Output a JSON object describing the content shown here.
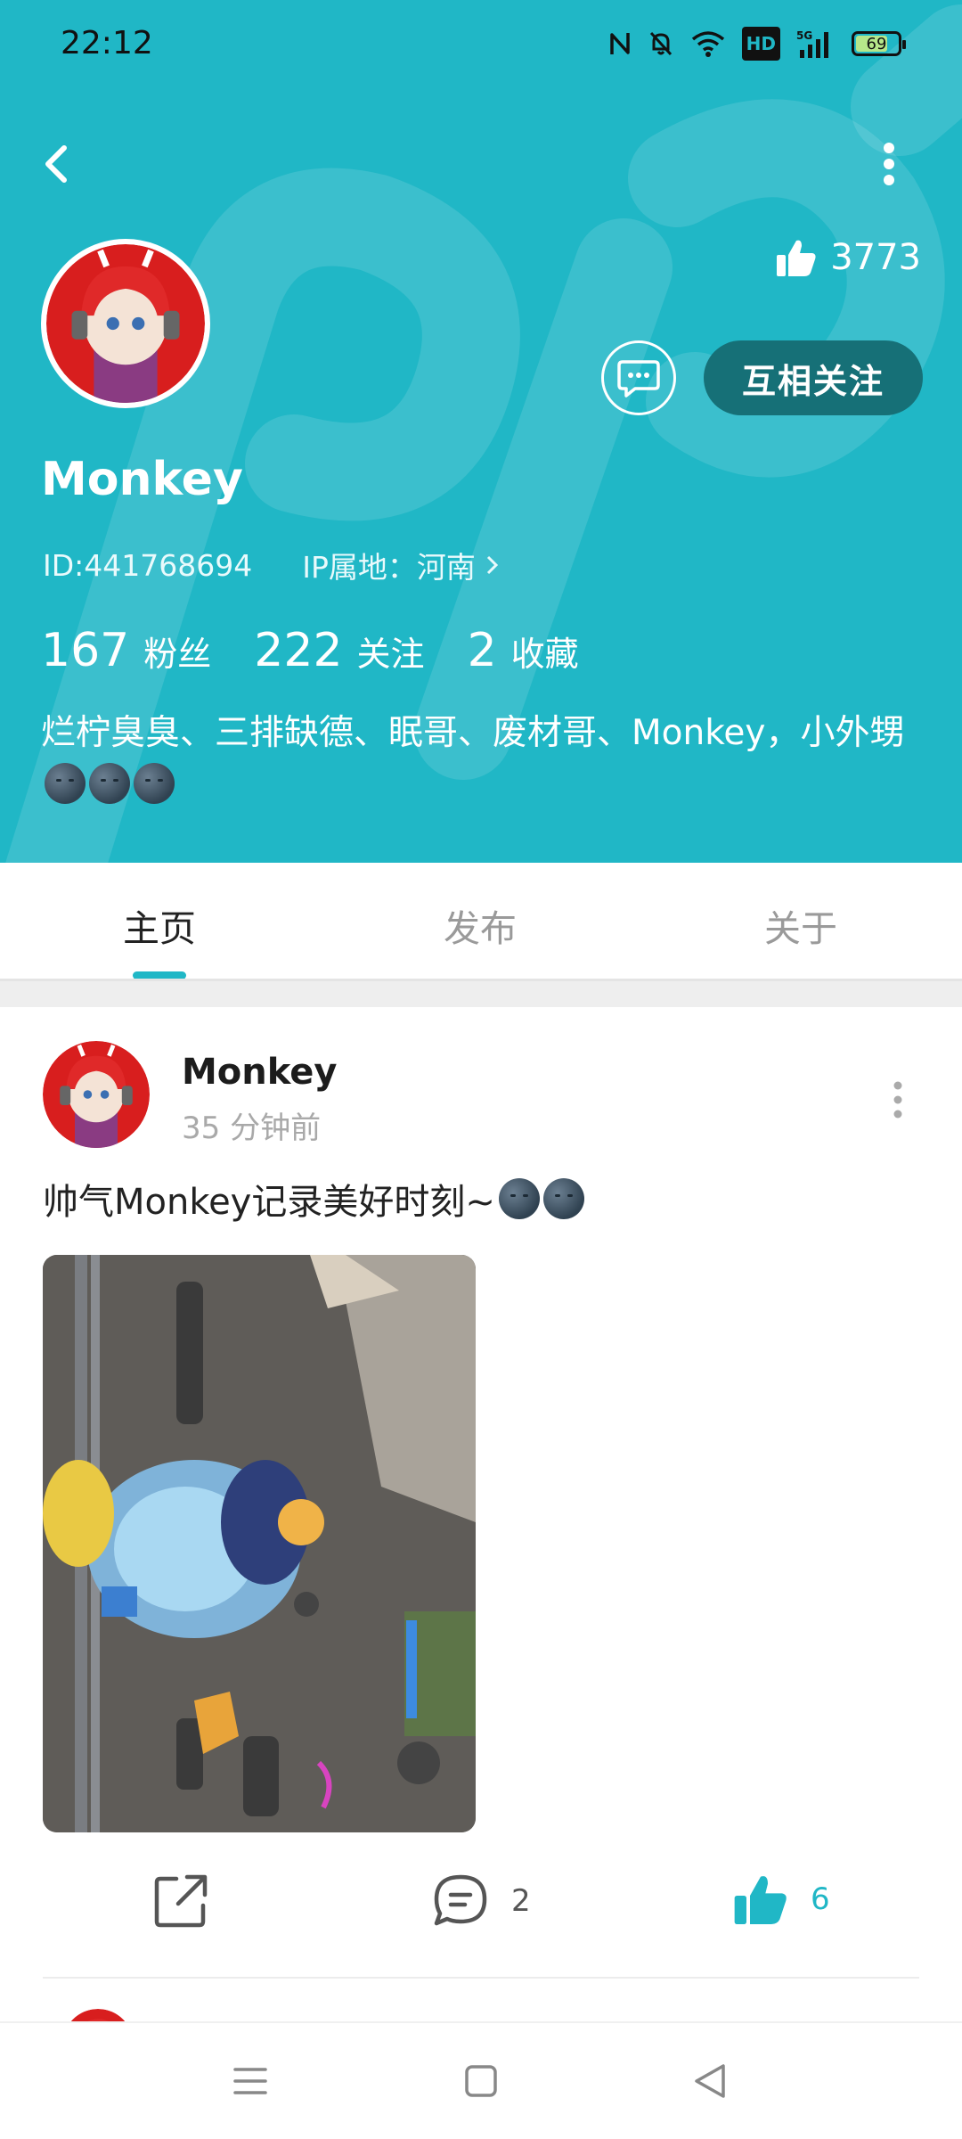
{
  "status_bar": {
    "time": "22:12",
    "network": "5G",
    "hd": "HD",
    "battery": "69",
    "battery_level": 0.69
  },
  "icons": {
    "back": "chevron-left-icon",
    "more": "more-vertical-icon",
    "like": "thumbs-up-icon",
    "message": "chat-bubble-icon",
    "share": "share-icon",
    "comment": "comment-icon"
  },
  "profile": {
    "likes": "3773",
    "message_button": "message",
    "follow_button": "互相关注",
    "name": "Monkey",
    "id": "ID:441768694",
    "ip": "IP属地：河南",
    "stats": [
      {
        "num": "167",
        "label": "粉丝"
      },
      {
        "num": "222",
        "label": "关注"
      },
      {
        "num": "2",
        "label": "收藏"
      }
    ],
    "bio": "烂柠臭臭、三排缺德、眠哥、废材哥、Monkey，小外甥"
  },
  "tabs": [
    "主页",
    "发布",
    "关于"
  ],
  "active_tab": 0,
  "post": {
    "author": "Monkey",
    "time": "35 分钟前",
    "text": "帅气Monkey记录美好时刻~",
    "comments": "2",
    "likes": "6"
  },
  "colors": {
    "accent": "#20b7c6",
    "follow_button": "#167077",
    "like_active": "#20b7c6"
  }
}
